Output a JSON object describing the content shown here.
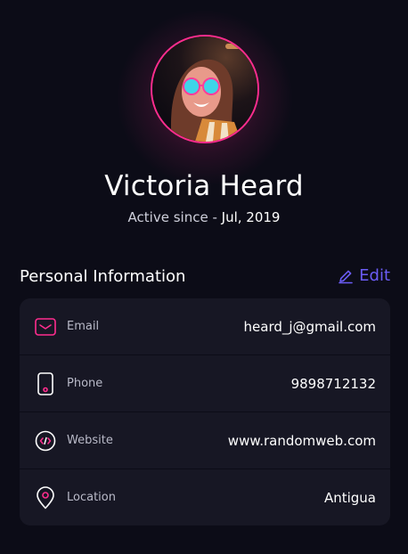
{
  "profile": {
    "name": "Victoria Heard",
    "active_prefix": "Active since - ",
    "active_date": "Jul, 2019"
  },
  "section": {
    "title": "Personal Information",
    "edit_label": "Edit"
  },
  "info_rows": [
    {
      "icon": "mail-icon",
      "label": "Email",
      "value": "heard_j@gmail.com"
    },
    {
      "icon": "phone-icon",
      "label": "Phone",
      "value": "9898712132"
    },
    {
      "icon": "code-icon",
      "label": "Website",
      "value": "www.randomweb.com"
    },
    {
      "icon": "location-pin-icon",
      "label": "Location",
      "value": "Antigua"
    }
  ],
  "colors": {
    "background": "#0c0c17",
    "card": "#171724",
    "accent_pink": "#ff2d8e",
    "accent_purple": "#6b5cf6"
  }
}
